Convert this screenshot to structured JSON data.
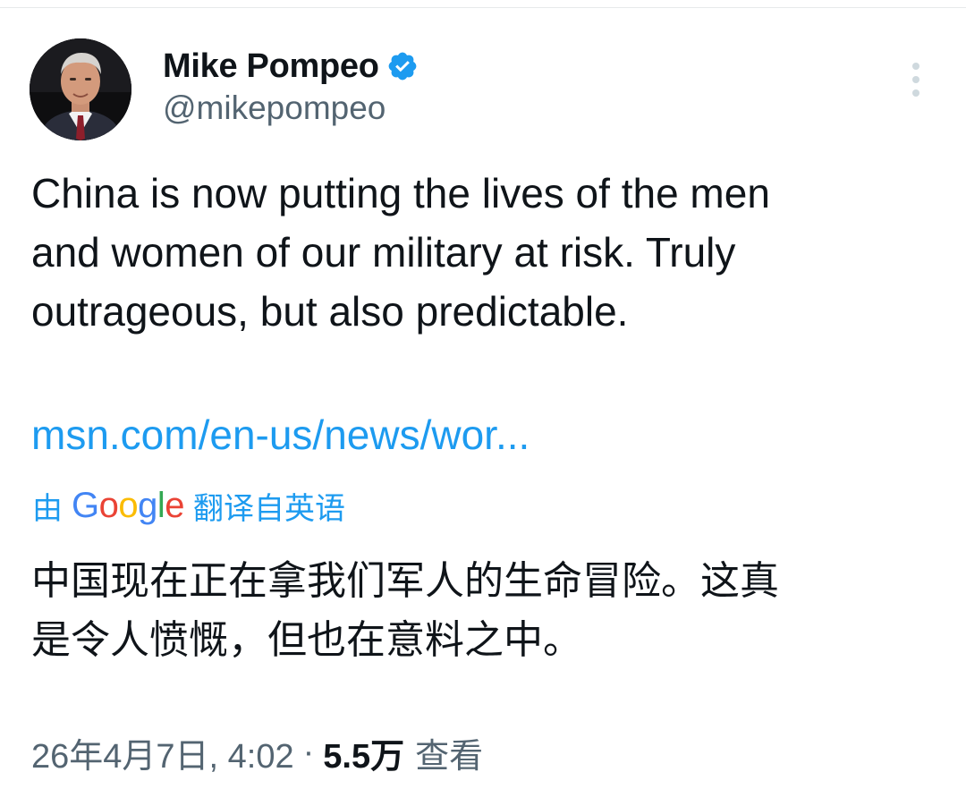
{
  "tweet": {
    "author": {
      "name": "Mike Pompeo",
      "handle": "@mikepompeo",
      "verified": true
    },
    "text": "China is now putting the lives of the men\nand women of our military at risk. Truly\noutrageous, but also predictable.",
    "link": "msn.com/en-us/news/wor...",
    "translation": {
      "prefix": "由",
      "provider_letters": [
        "G",
        "o",
        "o",
        "g",
        "l",
        "e"
      ],
      "suffix": "翻译自英语",
      "text": "中国现在正在拿我们军人的生命冒险。这真\n是令人愤慨，但也在意料之中。"
    },
    "meta": {
      "timestamp": "26年4月7日, 4:02",
      "separator": "·",
      "views_count": "5.5万",
      "views_label": "查看"
    }
  },
  "colors": {
    "link": "#1d9bf0",
    "verified_badge": "#1d9bf0",
    "secondary_text": "#536471",
    "primary_text": "#0f1419"
  },
  "icons": {
    "verified": "verified-badge-icon",
    "more": "more-vertical-icon"
  }
}
